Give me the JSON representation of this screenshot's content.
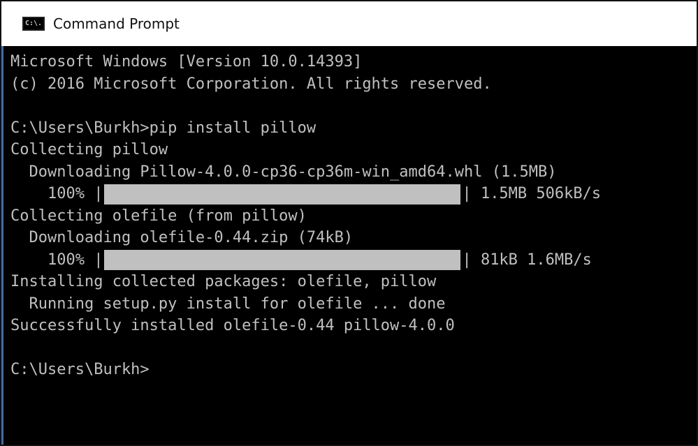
{
  "window": {
    "title": "Command Prompt",
    "icon_name": "console-app-icon",
    "icon_text": "C:\\."
  },
  "console": {
    "lines": [
      "Microsoft Windows [Version 10.0.14393]",
      "(c) 2016 Microsoft Corporation. All rights reserved.",
      "",
      "C:\\Users\\Burkh>pip install pillow",
      "Collecting pillow",
      "  Downloading Pillow-4.0.0-cp36-cp36m-win_amd64.whl (1.5MB)",
      "Collecting olefile (from pillow)",
      "  Downloading olefile-0.44.zip (74kB)",
      "Installing collected packages: olefile, pillow",
      "  Running setup.py install for olefile ... done",
      "Successfully installed olefile-0.44 pillow-4.0.0",
      "",
      "C:\\Users\\Burkh>"
    ],
    "progress": [
      {
        "prefix": "    100% |",
        "suffix": "| 1.5MB 506kB/s",
        "fraction": 1.0
      },
      {
        "prefix": "    100% |",
        "suffix": "| 81kB 1.6MB/s",
        "fraction": 1.0
      }
    ]
  },
  "colors": {
    "console_bg": "#000000",
    "console_text": "#c0c0c0",
    "progress_fill": "#c0c0c0",
    "titlebar_bg": "#ffffff",
    "left_accent": "#3c6ea8"
  }
}
